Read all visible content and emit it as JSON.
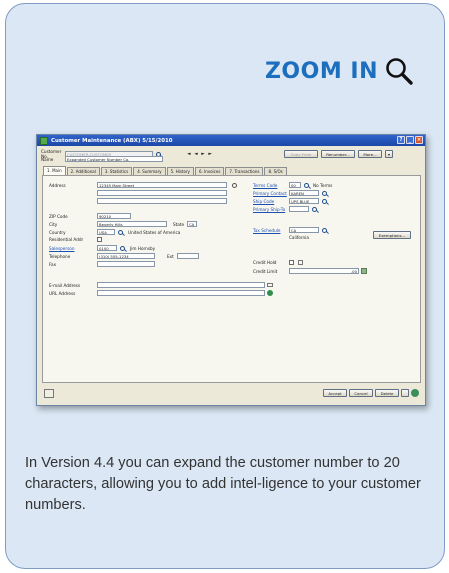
{
  "heading": {
    "zoom_label": "ZOOM IN",
    "icon": "magnifier-icon"
  },
  "caption": "In Version 4.4 you can expand the customer number to 20 characters, allowing you to add intel-ligence to your customer numbers.",
  "window": {
    "title": "Customer Maintenance (ABX) 5/15/2010",
    "customer_no_label": "Customer No.",
    "customer_no_value": "CUSTOMER-CUSTOMER",
    "name_label": "Name",
    "name_value": "Expanded Customer Number Co.",
    "nav_glyphs": "◄ ◄ ► ►",
    "copy_from": "Copy From",
    "renumber": "Renumber...",
    "more": "More..."
  },
  "tabs": [
    "1. Main",
    "2. Additional",
    "3. Statistics",
    "4. Summary",
    "5. History",
    "6. Invoices",
    "7. Transactions",
    "8. S/Os"
  ],
  "left_form": {
    "address_label": "Address",
    "address_1": "12345 Main Street",
    "zip_label": "ZIP Code",
    "zip_value": "90210",
    "city_label": "City",
    "city_value": "Beverly Hills",
    "state_label": "State",
    "state_value": "CA",
    "country_label": "Country",
    "country_code": "USA",
    "country_name": "United States of America",
    "residential_label": "Residential Addr",
    "salesperson_label": "Salesperson",
    "salesperson_code": "0100",
    "salesperson_name": "Jim Hornsby",
    "telephone_label": "Telephone",
    "telephone_value": "(310) 555-1234",
    "ext_label": "Ext",
    "fax_label": "Fax",
    "email_label": "E-mail Address",
    "url_label": "URL Address"
  },
  "right_form": {
    "terms_label": "Terms Code",
    "terms_code": "00",
    "terms_name": "No Terms",
    "contact_label": "Primary Contact",
    "contact_value": "KAREN",
    "shipvia_label": "Ship Code",
    "shipvia_value": "UPS BLUE",
    "shipto_label": "Primary Ship-To",
    "tax_label": "Tax Schedule",
    "tax_value": "CA",
    "tax_name": "California",
    "exemptions": "Exemptions...",
    "credit_hold_label": "Credit Hold",
    "credit_limit_label": "Credit Limit",
    "credit_limit_value": ".00"
  },
  "footer": {
    "accept": "Accept",
    "cancel": "Cancel",
    "delete": "Delete"
  }
}
